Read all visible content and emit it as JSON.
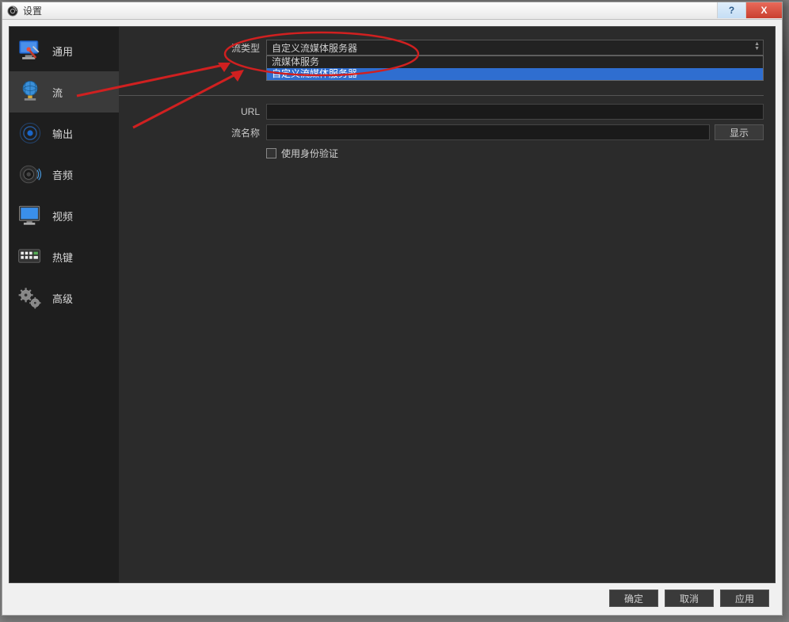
{
  "window": {
    "title": "设置"
  },
  "sidebar": {
    "items": [
      {
        "label": "通用"
      },
      {
        "label": "流"
      },
      {
        "label": "输出"
      },
      {
        "label": "音频"
      },
      {
        "label": "视频"
      },
      {
        "label": "热键"
      },
      {
        "label": "高级"
      }
    ],
    "selected_index": 1
  },
  "form": {
    "stream_type_label": "流类型",
    "stream_type_value": "自定义流媒体服务器",
    "url_label": "URL",
    "url_value": "",
    "stream_key_label": "流名称",
    "stream_key_value": "",
    "show_button": "显示",
    "use_auth_label": "使用身份验证"
  },
  "dropdown": {
    "options": [
      {
        "label": "流媒体服务"
      },
      {
        "label": "自定义流媒体服务器"
      }
    ],
    "highlighted_index": 1
  },
  "buttons": {
    "ok": "确定",
    "cancel": "取消",
    "apply": "应用"
  },
  "winctl": {
    "help": "?",
    "close": "X"
  }
}
